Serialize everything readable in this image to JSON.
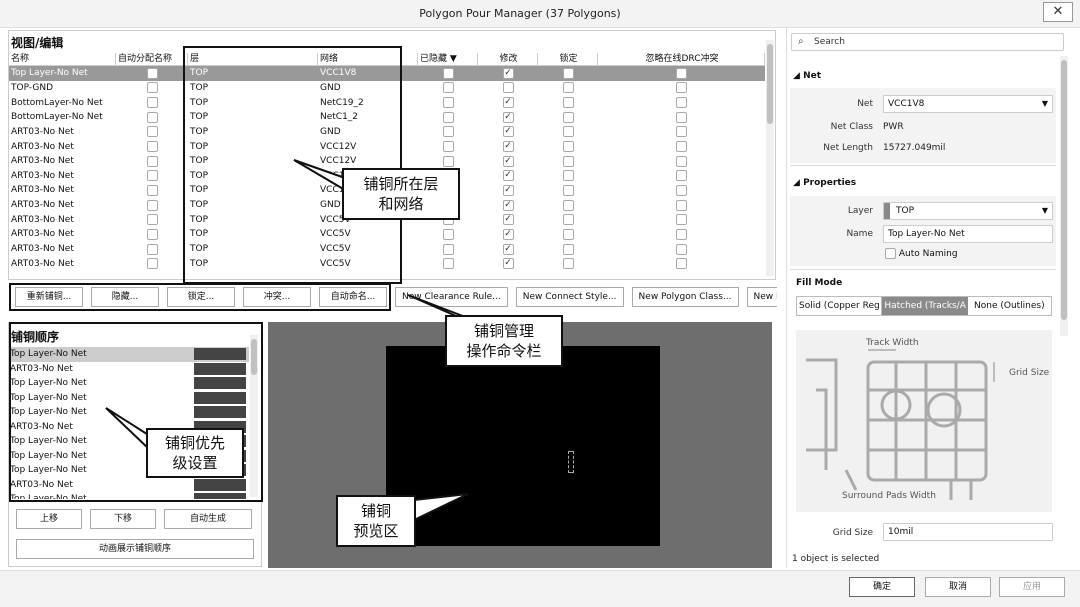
{
  "window": {
    "title": "Polygon Pour Manager (37 Polygons)",
    "close": "✕"
  },
  "view_edit": {
    "title": "视图/编辑",
    "columns": [
      "名称",
      "自动分配名称",
      "层",
      "网络",
      "已隐藏",
      "修改",
      "锁定",
      "忽略在线DRC冲突"
    ],
    "sort_icon": "▼",
    "rows": [
      {
        "name": "Top Layer-No Net",
        "layer": "TOP",
        "net": "VCC1V8",
        "modify": true
      },
      {
        "name": "TOP-GND",
        "layer": "TOP",
        "net": "GND",
        "modify": false
      },
      {
        "name": "BottomLayer-No Net",
        "layer": "TOP",
        "net": "NetC19_2",
        "modify": true
      },
      {
        "name": "BottomLayer-No Net",
        "layer": "TOP",
        "net": "NetC1_2",
        "modify": true
      },
      {
        "name": "ART03-No Net",
        "layer": "TOP",
        "net": "GND",
        "modify": true
      },
      {
        "name": "ART03-No Net",
        "layer": "TOP",
        "net": "VCC12V",
        "modify": true
      },
      {
        "name": "ART03-No Net",
        "layer": "TOP",
        "net": "VCC12V",
        "modify": true
      },
      {
        "name": "ART03-No Net",
        "layer": "TOP",
        "net": "VCC12V",
        "modify": true
      },
      {
        "name": "ART03-No Net",
        "layer": "TOP",
        "net": "VCC12V",
        "modify": true
      },
      {
        "name": "ART03-No Net",
        "layer": "TOP",
        "net": "GND",
        "modify": true
      },
      {
        "name": "ART03-No Net",
        "layer": "TOP",
        "net": "VCC5V",
        "modify": true
      },
      {
        "name": "ART03-No Net",
        "layer": "TOP",
        "net": "VCC5V",
        "modify": true
      },
      {
        "name": "ART03-No Net",
        "layer": "TOP",
        "net": "VCC5V",
        "modify": true
      },
      {
        "name": "ART03-No Net",
        "layer": "TOP",
        "net": "VCC5V",
        "modify": true
      }
    ]
  },
  "commands": [
    "重新铺铜...",
    "隐藏...",
    "锁定...",
    "冲突...",
    "自动命名...",
    "New Clearance Rule...",
    "New Connect Style...",
    "New Polygon Class...",
    "New Po"
  ],
  "pour_order": {
    "title": "铺铜顺序",
    "items": [
      "Top Layer-No Net",
      "ART03-No Net",
      "Top Layer-No Net",
      "Top Layer-No Net",
      "Top Layer-No Net",
      "ART03-No Net",
      "Top Layer-No Net",
      "Top Layer-No Net",
      "Top Layer-No Net",
      "ART03-No Net",
      "Top Layer-No Net"
    ],
    "up": "上移",
    "down": "下移",
    "auto": "自动生成",
    "animate": "动画展示铺铜顺序"
  },
  "callouts": {
    "layer_net": [
      "铺铜所在层",
      "和网络"
    ],
    "cmd": [
      "铺铜管理",
      "操作命令栏"
    ],
    "priority": [
      "铺铜优先",
      "级设置"
    ],
    "preview": [
      "铺铜",
      "预览区"
    ]
  },
  "right": {
    "search_placeholder": "Search",
    "net_section": "Net",
    "net_label": "Net",
    "net_value": "VCC1V8",
    "netclass_label": "Net Class",
    "netclass_value": "PWR",
    "netlen_label": "Net Length",
    "netlen_value": "15727.049mil",
    "props_section": "Properties",
    "layer_label": "Layer",
    "layer_value": "TOP",
    "name_label": "Name",
    "name_value": "Top Layer-No Net",
    "auto_naming": "Auto Naming",
    "fill_mode": "Fill Mode",
    "fill_opts": [
      "Solid (Copper Reg",
      "Hatched (Tracks/A",
      "None (Outlines)"
    ],
    "track_width": "Track Width",
    "grid_size_lbl": "Grid Size",
    "surround": "Surround Pads Width",
    "grid_size_label": "Grid Size",
    "grid_size_value": "10mil",
    "status": "1 object is selected"
  },
  "footer": {
    "ok": "确定",
    "cancel": "取消",
    "apply": "应用"
  },
  "colors": {
    "selected_row": "#999999",
    "preview_bg": "#6e6e6e",
    "board": "#000000"
  }
}
